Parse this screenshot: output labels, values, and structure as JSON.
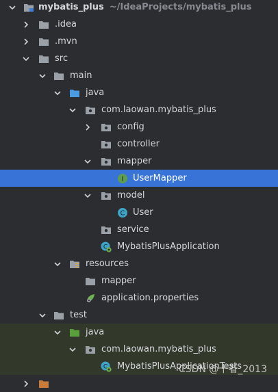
{
  "project": {
    "name": "mybatis_plus",
    "path": "~/IdeaProjects/mybatis_plus"
  },
  "rows": {
    "root": {
      "label": "mybatis_plus",
      "path": "~/IdeaProjects/mybatis_plus"
    },
    "idea": {
      "label": ".idea"
    },
    "mvn": {
      "label": ".mvn"
    },
    "src": {
      "label": "src"
    },
    "main": {
      "label": "main"
    },
    "java_main": {
      "label": "java"
    },
    "pkg_main": {
      "label": "com.laowan.mybatis_plus"
    },
    "config": {
      "label": "config"
    },
    "controller": {
      "label": "controller"
    },
    "mapper": {
      "label": "mapper"
    },
    "user_mapper": {
      "label": "UserMapper"
    },
    "model": {
      "label": "model"
    },
    "user": {
      "label": "User"
    },
    "service": {
      "label": "service"
    },
    "app": {
      "label": "MybatisPlusApplication"
    },
    "resources": {
      "label": "resources"
    },
    "res_mapper": {
      "label": "mapper"
    },
    "app_props": {
      "label": "application.properties"
    },
    "test": {
      "label": "test"
    },
    "java_test": {
      "label": "java"
    },
    "pkg_test": {
      "label": "com.laowan.mybatis_plus"
    },
    "app_tests": {
      "label": "MybatisPlusApplicationTests"
    }
  },
  "watermark": "CSDN @十者_2013",
  "colors": {
    "background": "#2b2d30",
    "selection": "#3874d8",
    "test_background": "#32392b",
    "folder": "#9aa0a8",
    "source_folder": "#4c9be0",
    "test_folder": "#5a9e3e",
    "class_icon": "#3fa3c6",
    "interface_icon": "#5c9e4e"
  },
  "icons": {
    "collapsed": "chevron-right-icon",
    "expanded": "chevron-down-icon",
    "folder": "folder-icon",
    "package": "package-icon",
    "class": "class-icon",
    "interface": "interface-icon",
    "spring_boot_app": "spring-boot-class-icon",
    "properties": "spring-properties-icon"
  }
}
